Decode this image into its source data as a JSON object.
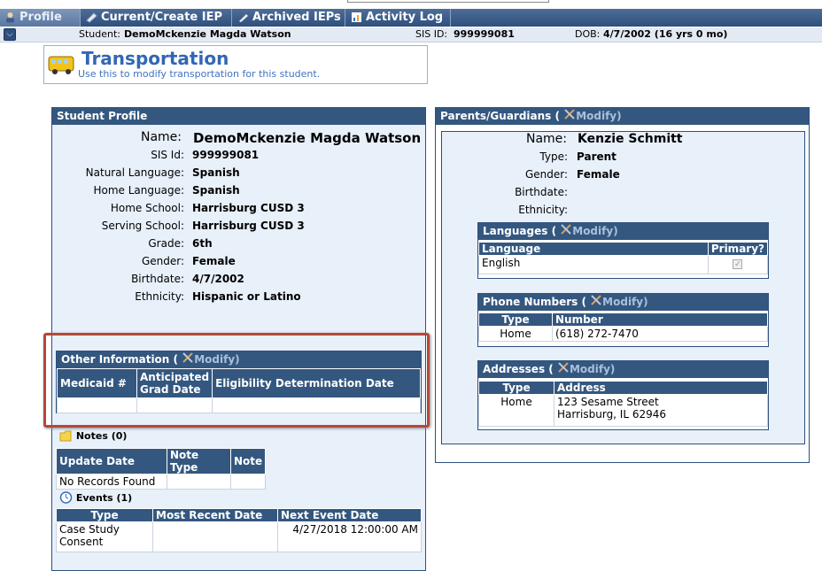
{
  "tabs": [
    {
      "label": "Profile"
    },
    {
      "label": "Current/Create IEP"
    },
    {
      "label": "Archived IEPs"
    },
    {
      "label": "Activity Log"
    }
  ],
  "infobar": {
    "student_label": "Student:",
    "student_value": "DemoMckenzie Magda Watson",
    "sis_label": "SIS ID:",
    "sis_value": "999999081",
    "dob_label": "DOB:",
    "dob_value": "4/7/2002 (16 yrs 0 mo)"
  },
  "header": {
    "title": "Transportation",
    "subtitle": "Use this to modify transportation for this student."
  },
  "student_profile": {
    "title": "Student Profile",
    "fields": [
      {
        "label": "Name:",
        "value": "DemoMckenzie Magda Watson"
      },
      {
        "label": "SIS Id:",
        "value": "999999081"
      },
      {
        "label": "Natural Language:",
        "value": "Spanish"
      },
      {
        "label": "Home Language:",
        "value": "Spanish"
      },
      {
        "label": "Home School:",
        "value": "Harrisburg CUSD 3"
      },
      {
        "label": "Serving School:",
        "value": "Harrisburg CUSD 3"
      },
      {
        "label": "Grade:",
        "value": "6th"
      },
      {
        "label": "Gender:",
        "value": "Female"
      },
      {
        "label": "Birthdate:",
        "value": "4/7/2002"
      },
      {
        "label": "Ethnicity:",
        "value": "Hispanic or Latino"
      }
    ]
  },
  "other_info": {
    "title": "Other Information (",
    "modify": "Modify",
    "close": ")",
    "columns": [
      "Medicaid #",
      "Anticipated Grad Date",
      "Eligibility Determination Date"
    ]
  },
  "notes": {
    "title": "Notes (0)",
    "columns": [
      "Update Date",
      "Note Type",
      "Note"
    ],
    "empty": "No Records Found"
  },
  "events": {
    "title": "Events (1)",
    "columns": [
      "Type",
      "Most Recent Date",
      "Next Event Date"
    ],
    "rows": [
      {
        "type": "Case Study Consent",
        "recent": "",
        "next": "4/27/2018 12:00:00 AM"
      }
    ]
  },
  "parents": {
    "title": "Parents/Guardians (",
    "modify": "Modify",
    "close": ")",
    "fields": [
      {
        "label": "Name:",
        "value": "Kenzie Schmitt"
      },
      {
        "label": "Type:",
        "value": "Parent"
      },
      {
        "label": "Gender:",
        "value": "Female"
      },
      {
        "label": "Birthdate:",
        "value": ""
      },
      {
        "label": "Ethnicity:",
        "value": ""
      }
    ],
    "languages": {
      "title": "Languages (",
      "modify": "Modify",
      "close": ")",
      "columns": [
        "Language",
        "Primary?"
      ],
      "rows": [
        {
          "language": "English",
          "primary": true
        }
      ]
    },
    "phones": {
      "title": "Phone Numbers (",
      "modify": "Modify",
      "close": ")",
      "columns": [
        "Type",
        "Number"
      ],
      "rows": [
        {
          "type": "Home",
          "number": "(618) 272-7470"
        }
      ]
    },
    "addresses": {
      "title": "Addresses (",
      "modify": "Modify",
      "close": ")",
      "columns": [
        "Type",
        "Address"
      ],
      "rows": [
        {
          "type": "Home",
          "line1": "123 Sesame Street",
          "line2": "Harrisburg, IL 62946"
        }
      ]
    }
  },
  "colors": {
    "header_blue": "#34577f",
    "panel_bg": "#e8f0fa",
    "title_blue": "#3167b5",
    "highlight": "#b5473a"
  }
}
